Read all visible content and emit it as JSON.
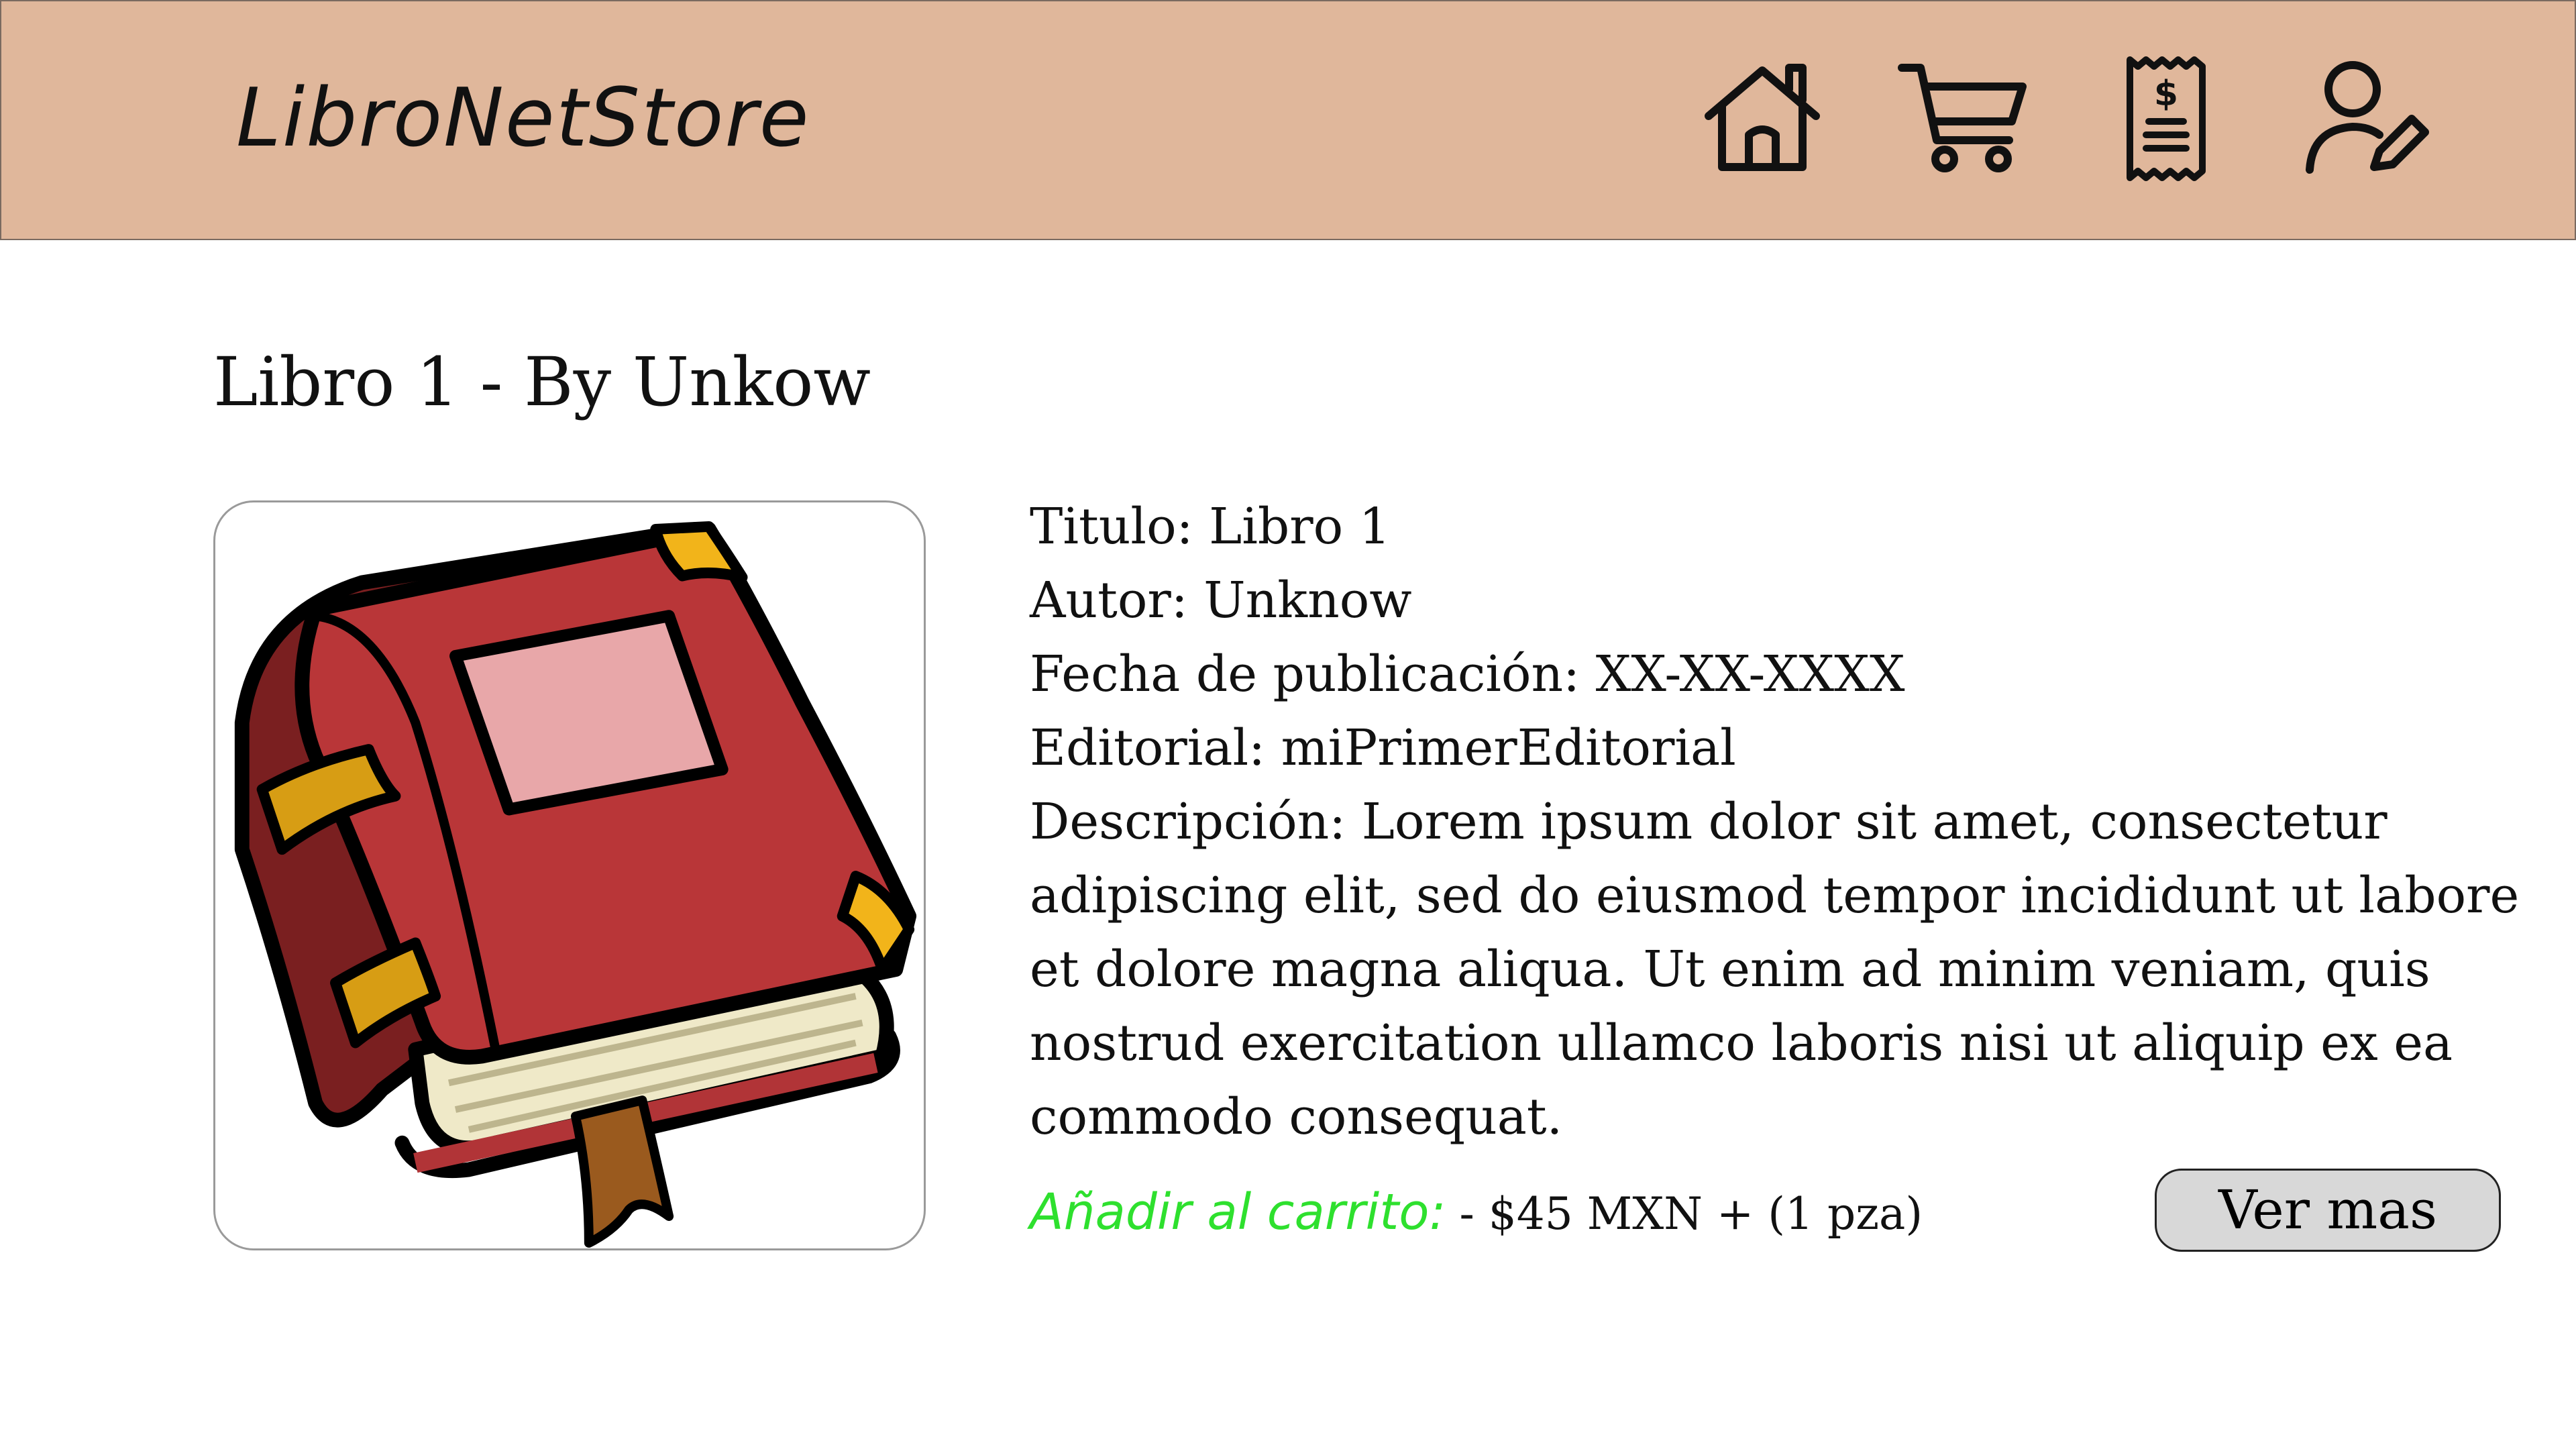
{
  "header": {
    "brand": "LibroNetStore",
    "nav": [
      {
        "icon": "home-icon"
      },
      {
        "icon": "cart-icon"
      },
      {
        "icon": "receipt-icon"
      },
      {
        "icon": "user-edit-icon"
      }
    ],
    "background_color": "#e0b79b"
  },
  "product": {
    "page_title": "Libro 1 - By Unkow",
    "cover_icon": "book-illustration",
    "details": {
      "titulo": "Titulo: Libro 1",
      "autor": "Autor: Unknow",
      "fecha": "Fecha de publicación: XX-XX-XXXX",
      "editorial": "Editorial: miPrimerEditorial",
      "descripcion": "Descripción: Lorem ipsum dolor sit amet, consectetur adipiscing elit, sed do eiusmod tempor incididunt ut labore et dolore magna aliqua. Ut enim ad minim veniam, quis nostrud exercitation ullamco laboris nisi ut aliquip ex ea commodo consequat."
    },
    "add_to_cart_label": "Añadir al carrito:",
    "price_text": "- $45 MXN + (1 pza)",
    "more_button_label": "Ver mas",
    "accent_color": "#2ee02e"
  }
}
